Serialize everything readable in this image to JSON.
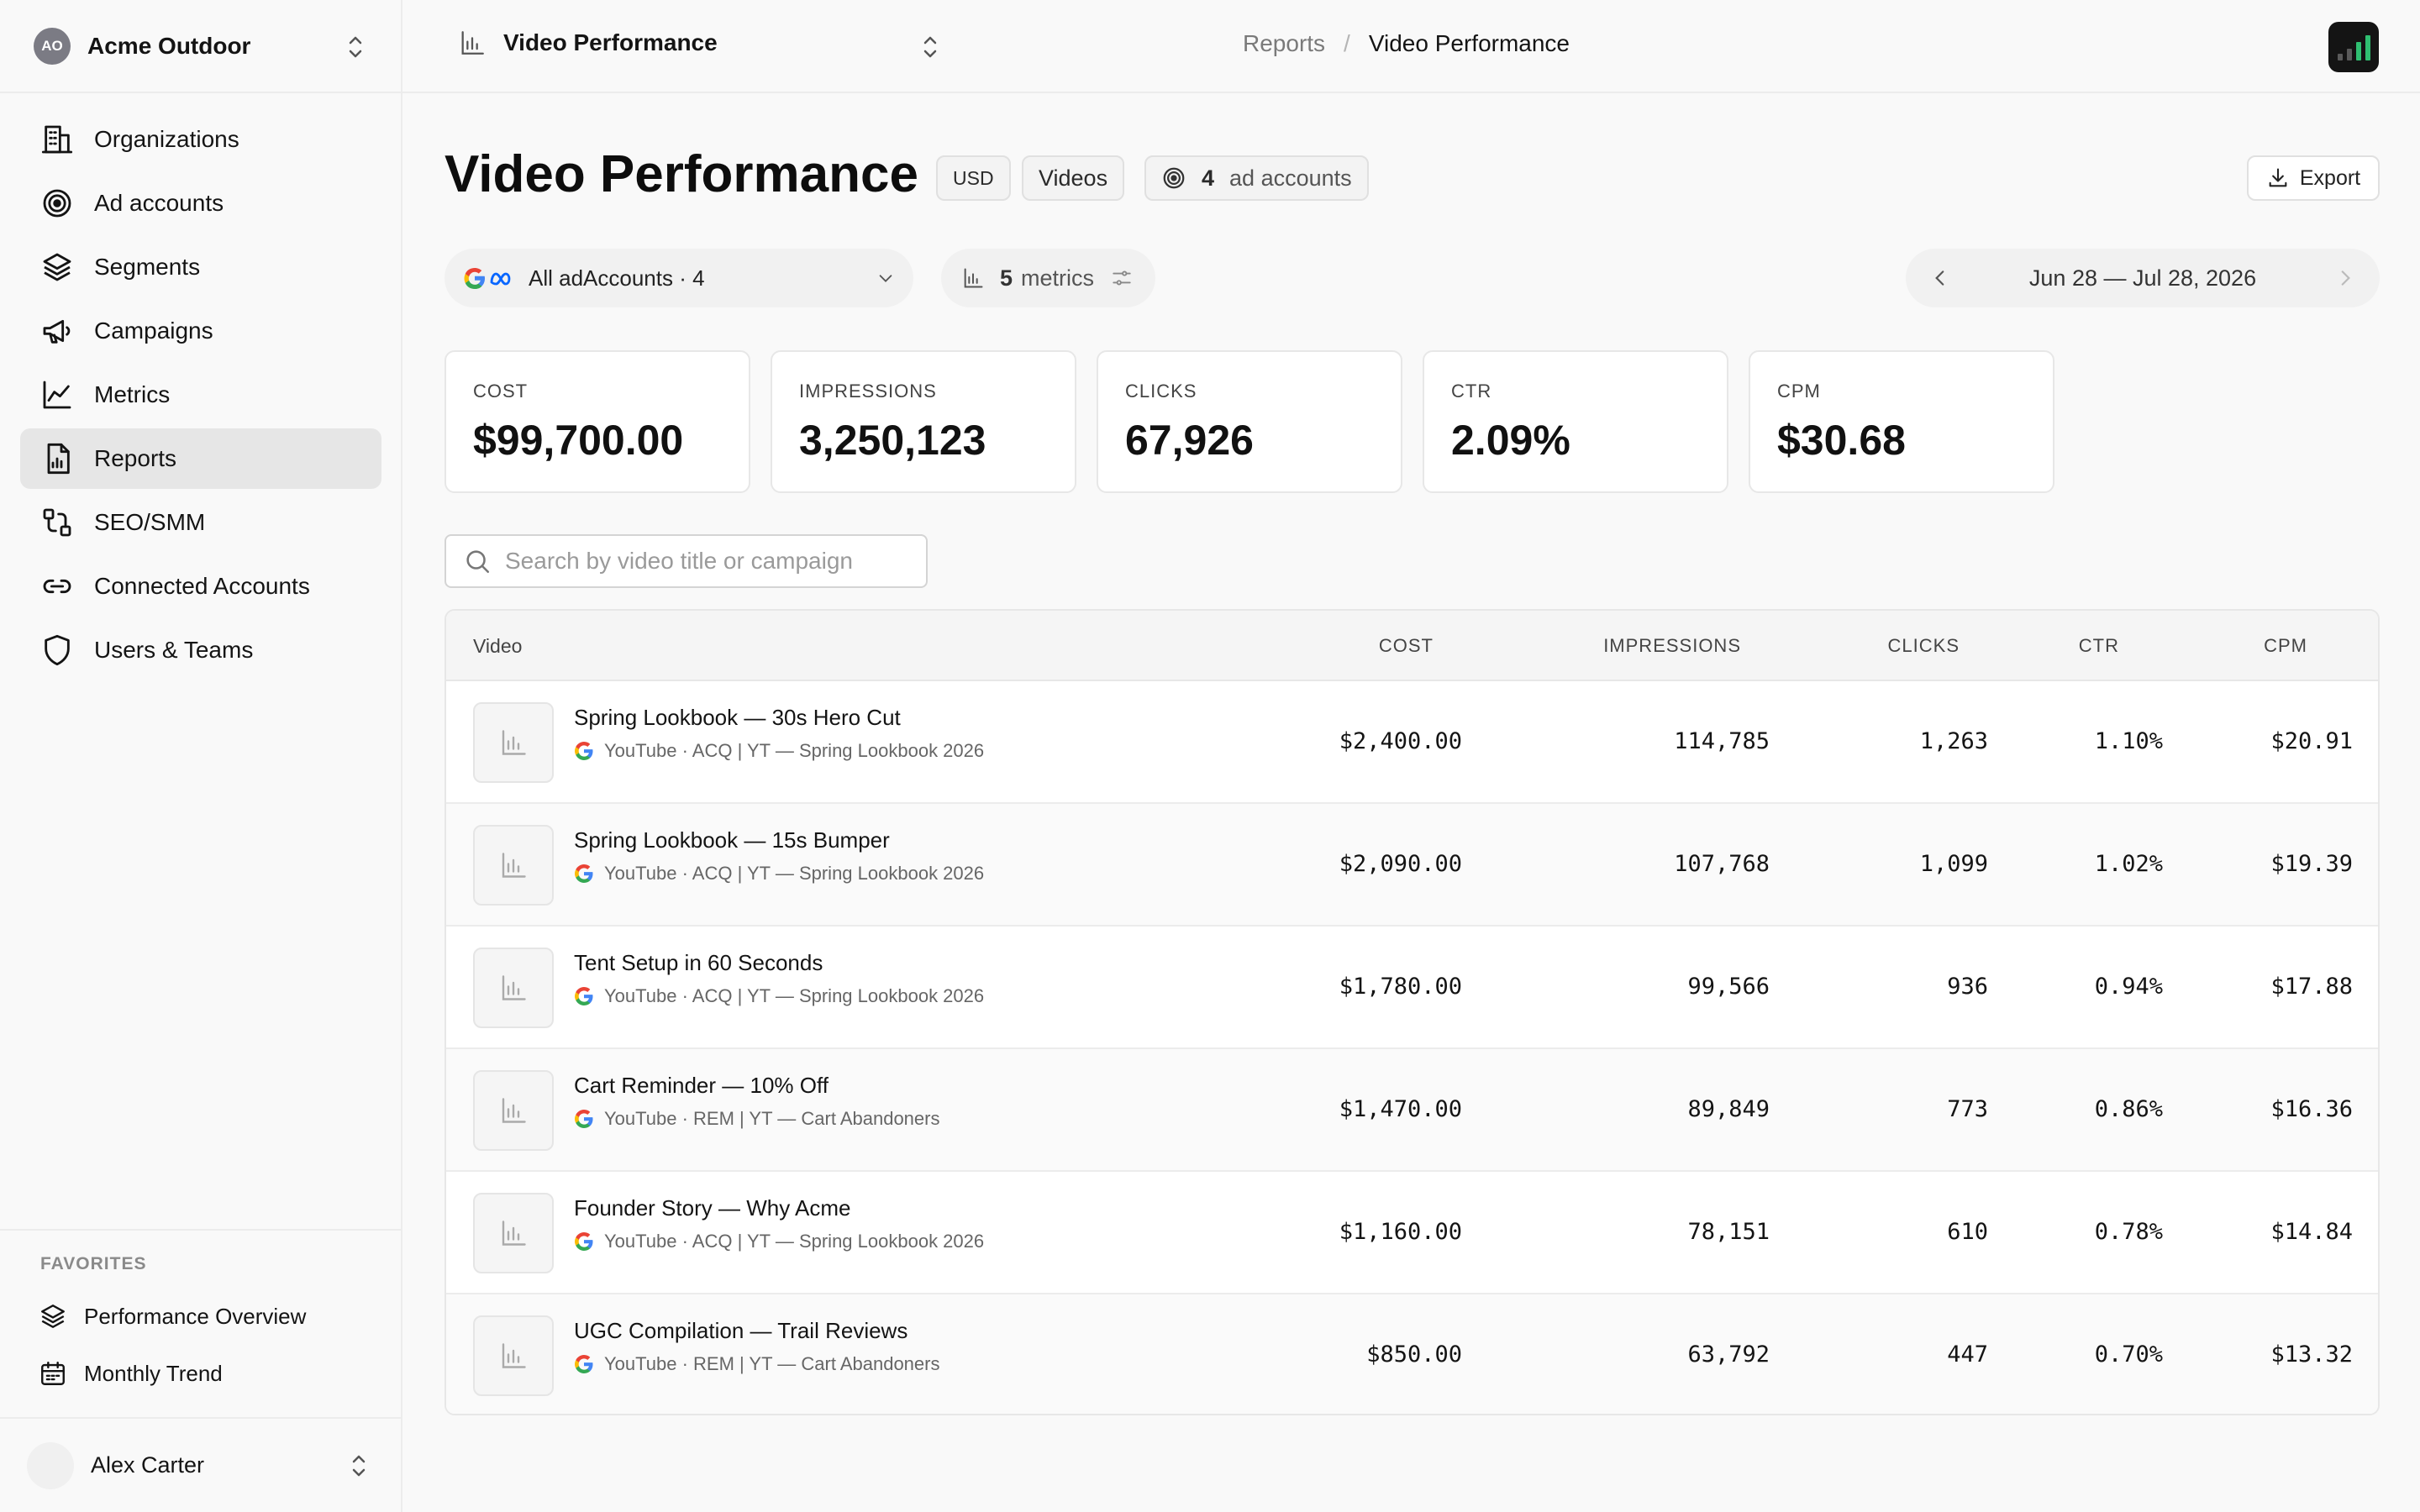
{
  "org": {
    "initials": "AO",
    "name": "Acme Outdoor"
  },
  "nav": [
    {
      "label": "Organizations",
      "icon": "building-icon"
    },
    {
      "label": "Ad accounts",
      "icon": "target-icon"
    },
    {
      "label": "Segments",
      "icon": "layers-icon"
    },
    {
      "label": "Campaigns",
      "icon": "megaphone-icon"
    },
    {
      "label": "Metrics",
      "icon": "line-chart-icon"
    },
    {
      "label": "Reports",
      "icon": "report-icon",
      "active": true
    },
    {
      "label": "SEO/SMM",
      "icon": "route-icon"
    },
    {
      "label": "Connected Accounts",
      "icon": "link-icon"
    },
    {
      "label": "Users & Teams",
      "icon": "shield-icon"
    }
  ],
  "favorites": {
    "title": "FAVORITES",
    "items": [
      {
        "label": "Performance Overview",
        "icon": "layers-icon"
      },
      {
        "label": "Monthly Trend",
        "icon": "calendar-icon"
      }
    ]
  },
  "user": {
    "name": "Alex Carter"
  },
  "header": {
    "report_name": "Video Performance",
    "breadcrumb": [
      "Reports",
      "Video Performance"
    ],
    "accent": "#2fbf71"
  },
  "page": {
    "title": "Video Performance",
    "currency": "USD",
    "view": "Videos",
    "account_count": "4",
    "account_label": "ad accounts",
    "export_label": "Export"
  },
  "filters": {
    "accounts": "All adAccounts · 4",
    "metrics_count": "5",
    "metrics_label": "metrics",
    "date_range": "Jun 28 — Jul 28, 2026"
  },
  "kpis": [
    {
      "label": "COST",
      "value": "$99,700.00"
    },
    {
      "label": "IMPRESSIONS",
      "value": "3,250,123"
    },
    {
      "label": "CLICKS",
      "value": "67,926"
    },
    {
      "label": "CTR",
      "value": "2.09%"
    },
    {
      "label": "CPM",
      "value": "$30.68"
    }
  ],
  "search": {
    "placeholder": "Search by video title or campaign",
    "value": ""
  },
  "table": {
    "columns": [
      "Video",
      "COST",
      "IMPRESSIONS",
      "CLICKS",
      "CTR",
      "CPM"
    ],
    "rows": [
      {
        "title": "Spring Lookbook — 30s Hero Cut",
        "sub": "YouTube · ACQ | YT — Spring Lookbook 2026",
        "cost": "$2,400.00",
        "impressions": "114,785",
        "clicks": "1,263",
        "ctr": "1.10%",
        "cpm": "$20.91"
      },
      {
        "title": "Spring Lookbook — 15s Bumper",
        "sub": "YouTube · ACQ | YT — Spring Lookbook 2026",
        "cost": "$2,090.00",
        "impressions": "107,768",
        "clicks": "1,099",
        "ctr": "1.02%",
        "cpm": "$19.39"
      },
      {
        "title": "Tent Setup in 60 Seconds",
        "sub": "YouTube · ACQ | YT — Spring Lookbook 2026",
        "cost": "$1,780.00",
        "impressions": "99,566",
        "clicks": "936",
        "ctr": "0.94%",
        "cpm": "$17.88"
      },
      {
        "title": "Cart Reminder — 10% Off",
        "sub": "YouTube · REM | YT — Cart Abandoners",
        "cost": "$1,470.00",
        "impressions": "89,849",
        "clicks": "773",
        "ctr": "0.86%",
        "cpm": "$16.36"
      },
      {
        "title": "Founder Story — Why Acme",
        "sub": "YouTube · ACQ | YT — Spring Lookbook 2026",
        "cost": "$1,160.00",
        "impressions": "78,151",
        "clicks": "610",
        "ctr": "0.78%",
        "cpm": "$14.84"
      },
      {
        "title": "UGC Compilation — Trail Reviews",
        "sub": "YouTube · REM | YT — Cart Abandoners",
        "cost": "$850.00",
        "impressions": "63,792",
        "clicks": "447",
        "ctr": "0.70%",
        "cpm": "$13.32"
      }
    ]
  }
}
